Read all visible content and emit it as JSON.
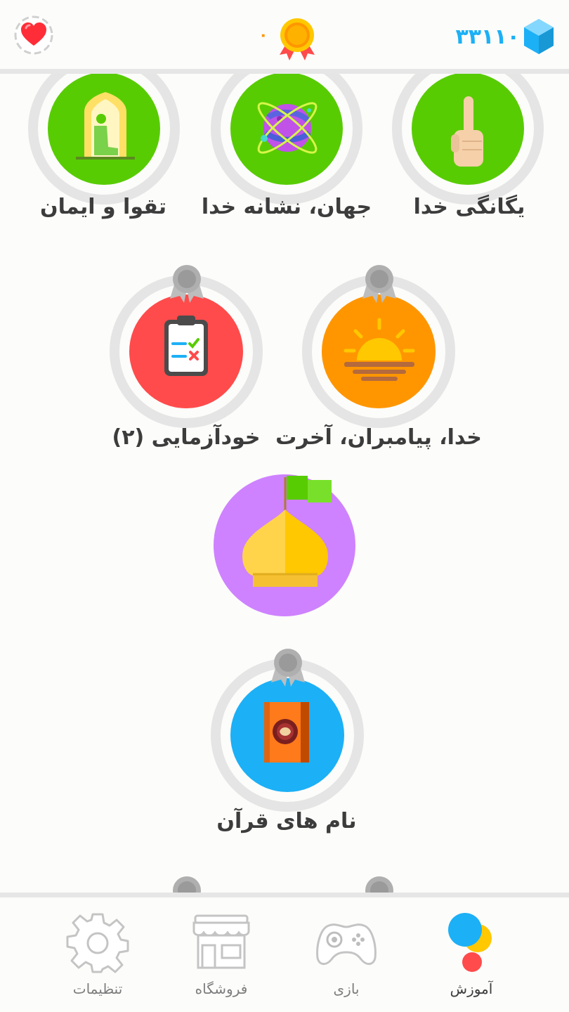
{
  "header": {
    "heart_icon": "heart-icon",
    "streak_count": "۰",
    "gem_count": "۳۳۱۱۰",
    "gem_icon": "gem-icon",
    "medal_icon": "medal-icon"
  },
  "skills": {
    "row1": [
      {
        "label": "یگانگی خدا",
        "icon": "pointing-finger-icon",
        "color": "#58cc02"
      },
      {
        "label": "جهان، نشانه خدا",
        "icon": "planet-icon",
        "color": "#58cc02"
      },
      {
        "label": "تقوا و ایمان",
        "icon": "praying-person-icon",
        "color": "#58cc02"
      }
    ],
    "row2": [
      {
        "label": "خدا، پیامبران، آخرت",
        "icon": "sunset-icon",
        "color": "#ff9600"
      },
      {
        "label": "خودآزمایی (۲)",
        "icon": "clipboard-icon",
        "color": "#ff4b4b"
      }
    ],
    "checkpoint": {
      "icon": "dome-flag-icon",
      "color": "#ce82ff"
    },
    "row3": [
      {
        "label": "نام های قرآن",
        "icon": "quran-book-icon",
        "color": "#1cb0f6"
      }
    ]
  },
  "nav": {
    "items": [
      {
        "label": "آموزش",
        "icon": "learn-dots-icon",
        "active": true
      },
      {
        "label": "بازی",
        "icon": "gamepad-icon",
        "active": false
      },
      {
        "label": "فروشگاه",
        "icon": "shop-icon",
        "active": false
      },
      {
        "label": "تنظیمات",
        "icon": "gear-icon",
        "active": false
      }
    ]
  }
}
